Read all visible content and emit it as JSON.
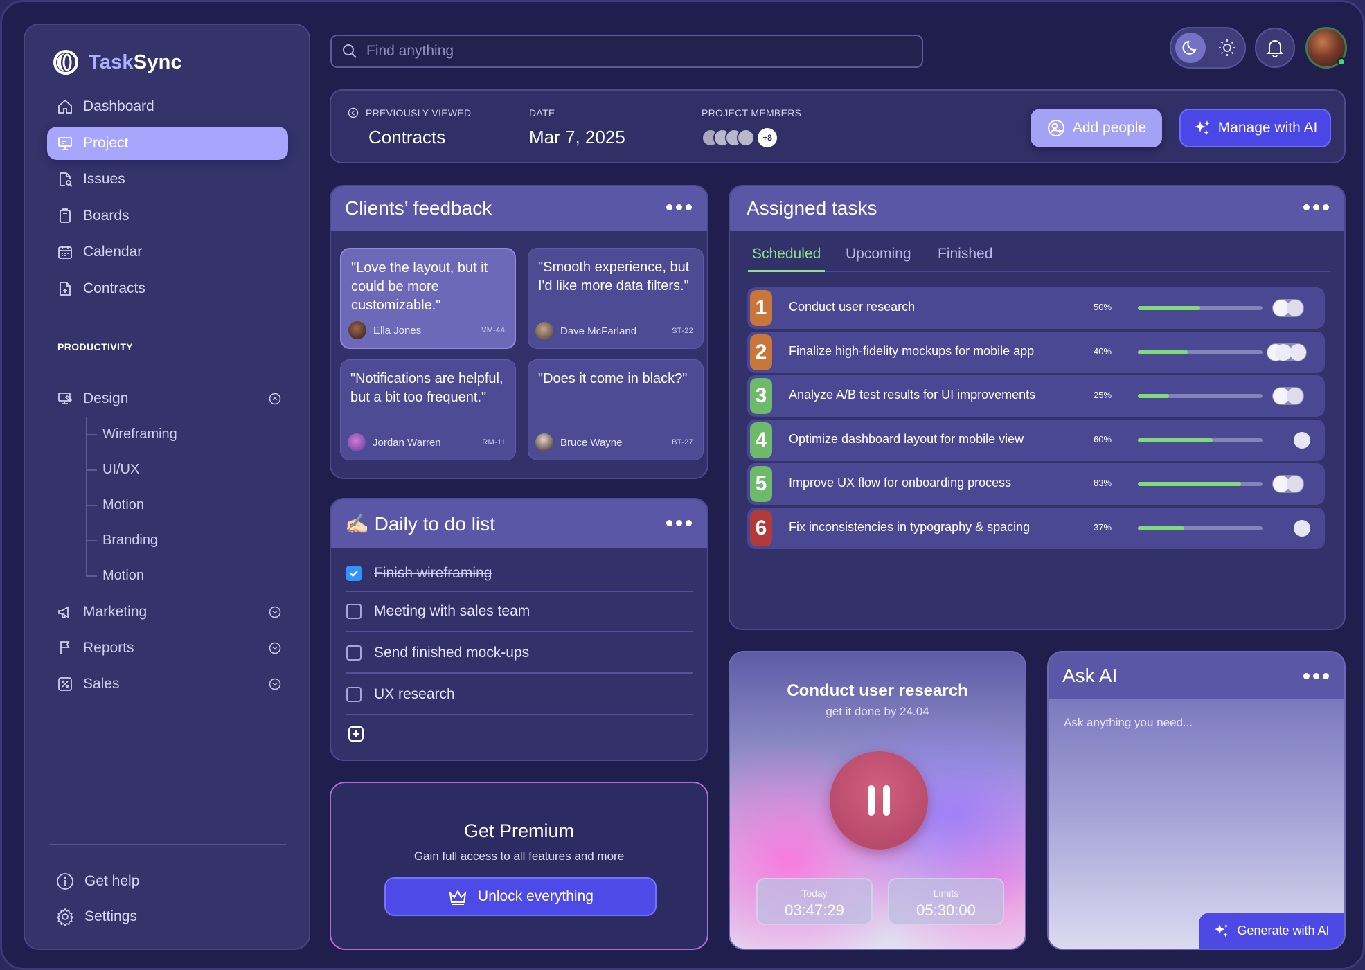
{
  "app": {
    "brand_first": "Task",
    "brand_second": "Sync"
  },
  "sidebar": {
    "nav": [
      {
        "label": "Dashboard",
        "icon": "home-icon"
      },
      {
        "label": "Project",
        "icon": "presentation-icon",
        "active": true
      },
      {
        "label": "Issues",
        "icon": "file-search-icon"
      },
      {
        "label": "Boards",
        "icon": "clipboard-icon"
      },
      {
        "label": "Calendar",
        "icon": "calendar-icon"
      },
      {
        "label": "Contracts",
        "icon": "file-plus-icon"
      }
    ],
    "section_label": "PRODUCTIVITY",
    "design": {
      "label": "Design",
      "icon": "monitor-pen-icon",
      "expanded": true,
      "children": [
        "Wireframing",
        "UI/UX",
        "Motion",
        "Branding",
        "Motion"
      ]
    },
    "marketing": {
      "label": "Marketing",
      "icon": "megaphone-icon"
    },
    "reports": {
      "label": "Reports",
      "icon": "flag-icon"
    },
    "sales": {
      "label": "Sales",
      "icon": "percent-icon"
    },
    "help": "Get help",
    "settings": "Settings"
  },
  "search": {
    "placeholder": "Find anything"
  },
  "infobar": {
    "prev_label": "PREVIOUSLY VIEWED",
    "prev_value": "Contracts",
    "date_label": "DATE",
    "date_value": "Mar 7, 2025",
    "members_label": "PROJECT MEMBERS",
    "members_extra": "+8",
    "add_people": "Add people",
    "manage_ai": "Manage with AI"
  },
  "feedback": {
    "title": "Clients’ feedback",
    "items": [
      {
        "quote": "\"Love the layout, but it could be more customizable.\"",
        "name": "Ella Jones",
        "code": "VM-44"
      },
      {
        "quote": "\"Smooth experience, but I'd like more data filters.\"",
        "name": "Dave McFarland",
        "code": "ST-22"
      },
      {
        "quote": "\"Notifications are helpful, but a bit too frequent.\"",
        "name": "Jordan Warren",
        "code": "RM-11"
      },
      {
        "quote": "\"Does it come in black?\"",
        "name": "Bruce Wayne",
        "code": "BT-27"
      }
    ]
  },
  "todo": {
    "title": "✍🏻 Daily to do list",
    "items": [
      {
        "label": "Finish wireframing",
        "done": true
      },
      {
        "label": "Meeting with sales team",
        "done": false
      },
      {
        "label": "Send finished mock-ups",
        "done": false
      },
      {
        "label": "UX research",
        "done": false
      }
    ]
  },
  "premium": {
    "title": "Get Premium",
    "subtitle": "Gain full access to all features and more",
    "button": "Unlock everything"
  },
  "tasks": {
    "title": "Assigned tasks",
    "tabs": [
      "Scheduled",
      "Upcoming",
      "Finished"
    ],
    "items": [
      {
        "num": "1",
        "label": "Conduct user research",
        "pct": "50%",
        "progress": 0.5,
        "color": "#c8763a",
        "toggle": "on"
      },
      {
        "num": "2",
        "label": "Finalize high-fidelity mockups for mobile app",
        "pct": "40%",
        "progress": 0.4,
        "color": "#c8763a",
        "toggle": "both"
      },
      {
        "num": "3",
        "label": "Analyze A/B test results for UI improvements",
        "pct": "25%",
        "progress": 0.25,
        "color": "#6cba6a",
        "toggle": "on"
      },
      {
        "num": "4",
        "label": "Optimize dashboard layout for mobile view",
        "pct": "60%",
        "progress": 0.6,
        "color": "#6cba6a",
        "toggle": "single"
      },
      {
        "num": "5",
        "label": "Improve UX flow for onboarding process",
        "pct": "83%",
        "progress": 0.83,
        "color": "#6cba6a",
        "toggle": "on"
      },
      {
        "num": "6",
        "label": "Fix inconsistencies in typography & spacing",
        "pct": "37%",
        "progress": 0.37,
        "color": "#b33a3a",
        "toggle": "single"
      }
    ]
  },
  "focus": {
    "title": "Conduct user research",
    "subtitle": "get it done by 24.04",
    "today_label": "Today",
    "today_value": "03:47:29",
    "limits_label": "Limits",
    "limits_value": "05:30:00"
  },
  "ask_ai": {
    "title": "Ask AI",
    "placeholder": "Ask anything you need...",
    "button": "Generate with AI"
  }
}
